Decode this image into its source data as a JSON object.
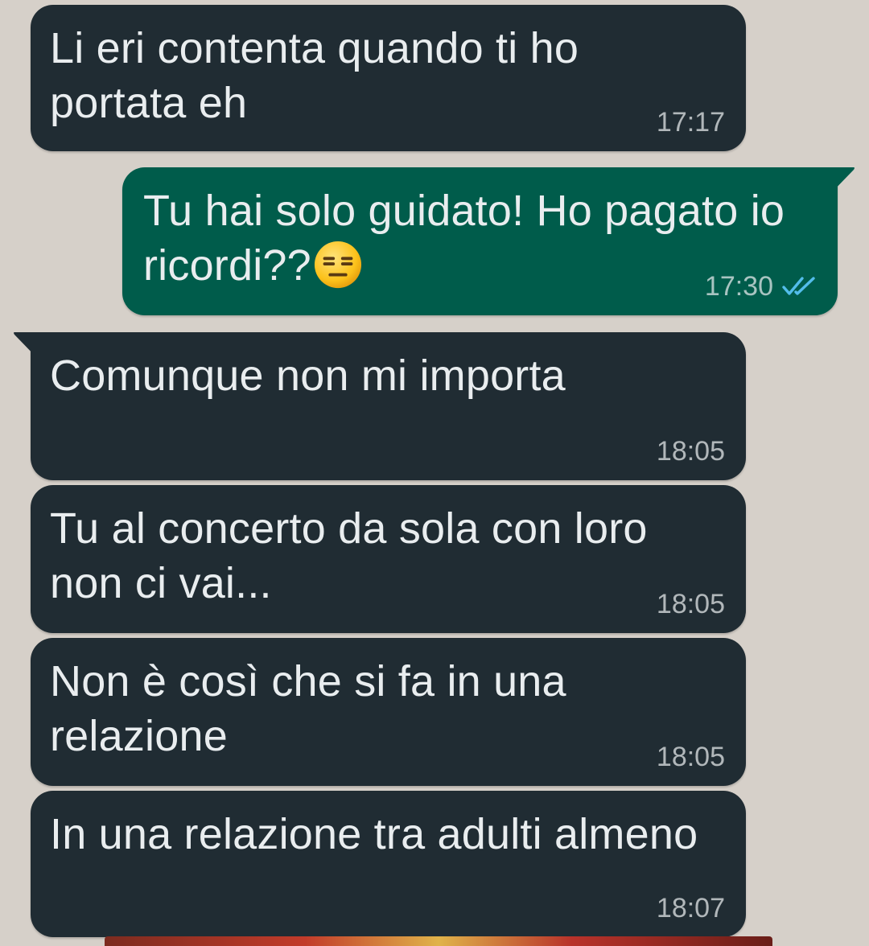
{
  "messages": [
    {
      "direction": "incoming",
      "text": "Li eri contenta quando ti ho portata eh",
      "time": "17:17"
    },
    {
      "direction": "outgoing",
      "text": "Tu hai solo guidato! Ho pagato io ricordi??",
      "emoji": "expressionless-face",
      "time": "17:30",
      "status": "read"
    },
    {
      "direction": "incoming",
      "text": "Comunque non mi importa",
      "time": "18:05"
    },
    {
      "direction": "incoming",
      "text": "Tu al concerto da sola con loro non ci vai...",
      "time": "18:05"
    },
    {
      "direction": "incoming",
      "text": "Non è così che si fa in una relazione",
      "time": "18:05"
    },
    {
      "direction": "incoming",
      "text": "In una relazione tra adulti almeno",
      "time": "18:07"
    }
  ],
  "colors": {
    "wallpaper": "#d6d0c9",
    "incoming_bubble": "#202c33",
    "outgoing_bubble": "#005c4b",
    "read_ticks": "#53bdeb"
  }
}
